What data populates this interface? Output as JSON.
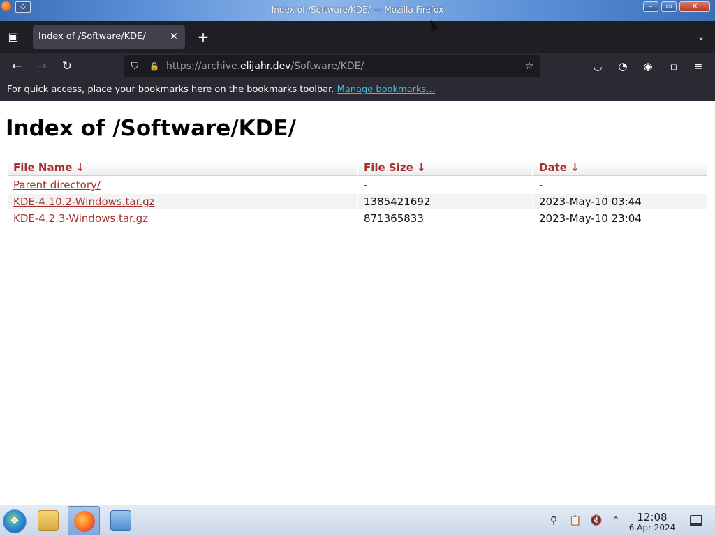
{
  "window": {
    "title": "Index of /Software/KDE/ — Mozilla Firefox",
    "minimize_glyph": "–",
    "maximize_glyph": "▭",
    "close_glyph": "✕"
  },
  "tabs": [
    {
      "label": "Index of /Software/KDE/",
      "active": true,
      "close_glyph": "✕"
    }
  ],
  "tabstrip": {
    "new_tab_glyph": "+",
    "list_all_tabs_glyph": "⌄",
    "overview_glyph": "▣"
  },
  "navbar": {
    "back_glyph": "←",
    "forward_glyph": "→",
    "reload_glyph": "↻",
    "url_prefix": "https://archive.",
    "url_host": "elijahr.dev",
    "url_path": "/Software/KDE/",
    "bookmark_star_glyph": "☆",
    "shield_glyph": "⛉",
    "lock_glyph": "🔒",
    "pocket_glyph": "◡",
    "sync_glyph": "◔",
    "account_glyph": "◉",
    "extensions_glyph": "⧉",
    "menu_glyph": "≡"
  },
  "bookmarks_bar": {
    "message": "For quick access, place your bookmarks here on the bookmarks toolbar.",
    "link": "Manage bookmarks…"
  },
  "page": {
    "title": "Index of /Software/KDE/",
    "columns": {
      "name": "File Name  ↓",
      "size": "File Size  ↓",
      "date": "Date  ↓"
    },
    "rows": [
      {
        "name": "Parent directory/",
        "size": "-",
        "date": "-"
      },
      {
        "name": "KDE-4.10.2-Windows.tar.gz",
        "size": "1385421692",
        "date": "2023-May-10 03:44"
      },
      {
        "name": "KDE-4.2.3-Windows.tar.gz",
        "size": "871365833",
        "date": "2023-May-10 23:04"
      }
    ]
  },
  "taskbar": {
    "start_glyph": "❖",
    "clock_time": "12:08",
    "clock_date": "6 Apr 2024",
    "tray_clipboard_glyph": "📋",
    "tray_mute_glyph": "🔇",
    "tray_expand_glyph": "⌃",
    "tray_network_glyph": "⚲"
  },
  "colors": {
    "link": "#a3322e",
    "bookmark_link": "#3ac0e0",
    "toolbar_bg": "#2b2a33",
    "tabstrip_bg": "#1f1e25"
  }
}
